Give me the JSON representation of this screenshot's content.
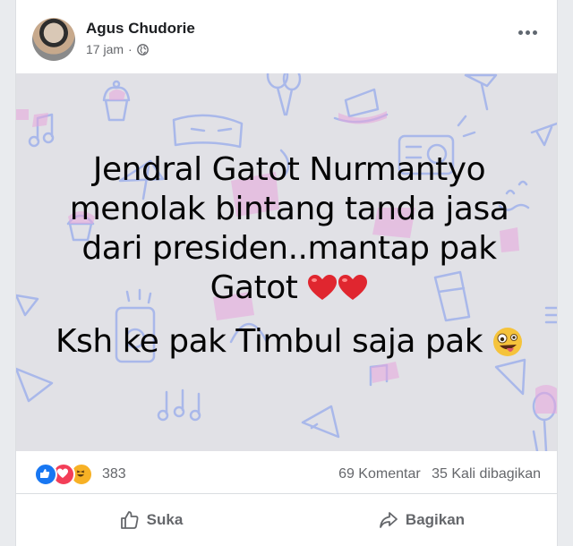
{
  "post": {
    "author": "Agus Chudorie",
    "time": "17 jam",
    "separator": "·",
    "text_line1": "Jendral Gatot Nurmantyo menolak bintang tanda jasa dari presiden..mantap pak Gatot",
    "text_line2": "Ksh ke pak Timbul saja pak",
    "emoji_hearts": "heart-icon x2",
    "emoji_face": "zany-face-icon",
    "background_color": "#e1e1e6"
  },
  "stats": {
    "reactions_count": "383",
    "comments": "69 Komentar",
    "shares": "35 Kali dibagikan"
  },
  "actions": {
    "like_label": "Suka",
    "share_label": "Bagikan"
  },
  "colors": {
    "like_blue": "#1877f2",
    "love_red": "#f33e58",
    "haha_yellow": "#f7b125",
    "doodle_blue": "#a9b8ea",
    "doodle_pink": "#e8a6dc"
  }
}
